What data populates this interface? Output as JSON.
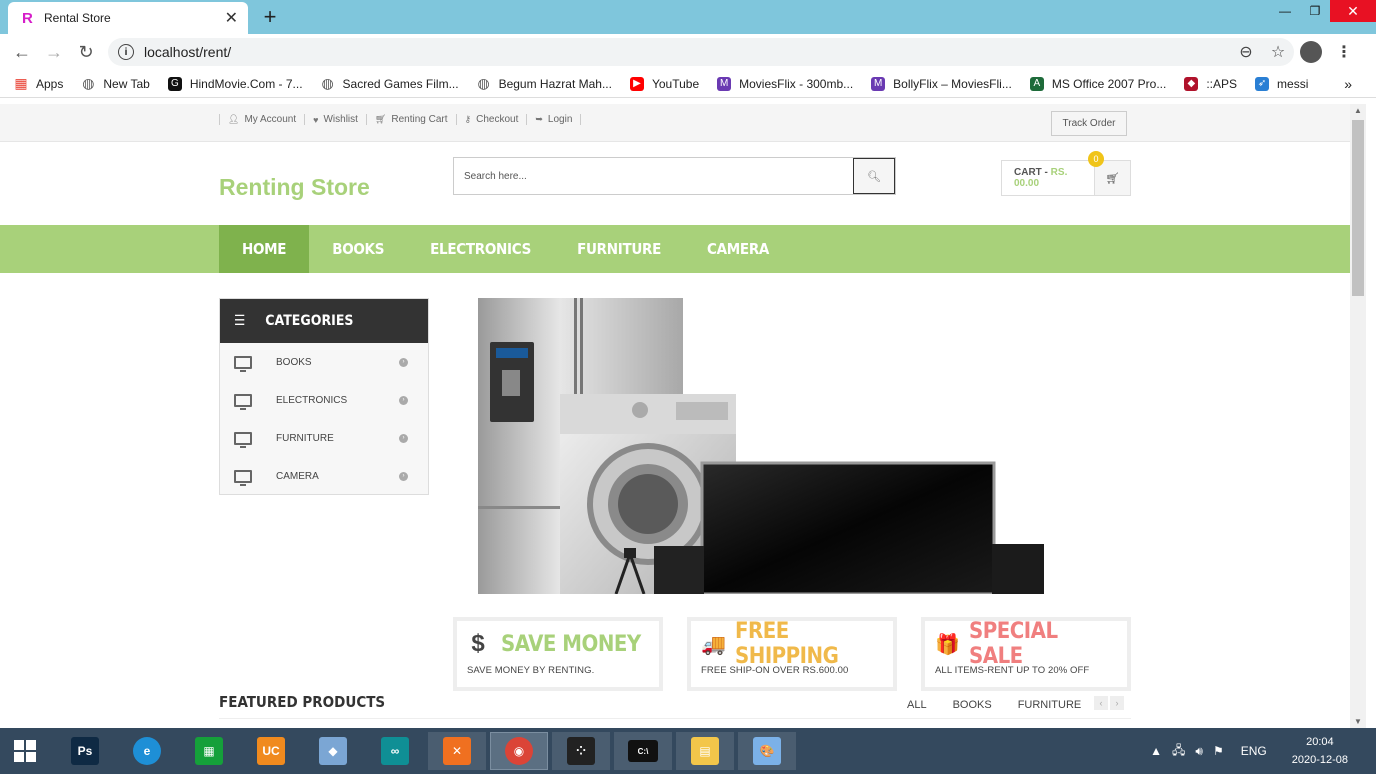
{
  "browser": {
    "tab_title": "Rental Store",
    "tab_favicon": "R",
    "url": "localhost/rent/",
    "bookmarks": [
      {
        "label": "Apps",
        "icon": "apps-grid-icon",
        "color": "#e94235"
      },
      {
        "label": "New Tab",
        "icon": "globe-icon",
        "color": "#555555"
      },
      {
        "label": "HindMovie.Com - 7...",
        "icon": "g-icon",
        "color": "#111111"
      },
      {
        "label": "Sacred Games Film...",
        "icon": "globe-icon",
        "color": "#555555"
      },
      {
        "label": "Begum Hazrat Mah...",
        "icon": "globe-icon",
        "color": "#555555"
      },
      {
        "label": "YouTube",
        "icon": "youtube-icon",
        "color": "#ff0000"
      },
      {
        "label": "MoviesFlix - 300mb...",
        "icon": "m-icon",
        "color": "#6a3ab2"
      },
      {
        "label": "BollyFlix – MoviesFli...",
        "icon": "m-icon",
        "color": "#6a3ab2"
      },
      {
        "label": "MS Office 2007 Pro...",
        "icon": "act-icon",
        "color": "#1e6b3a"
      },
      {
        "label": "::APS",
        "icon": "aps-icon",
        "color": "#b0122b"
      },
      {
        "label": "messi",
        "icon": "messi-icon",
        "color": "#2a7fd4"
      }
    ],
    "bookmarks_more": "»"
  },
  "site": {
    "top_links": [
      {
        "label": "My Account",
        "icon": "user-icon"
      },
      {
        "label": "Wishlist",
        "icon": "heart-icon"
      },
      {
        "label": "Renting Cart",
        "icon": "cart-icon"
      },
      {
        "label": "Checkout",
        "icon": "key-icon"
      },
      {
        "label": "Login",
        "icon": "sign-in-icon"
      }
    ],
    "track_order": "Track Order",
    "logo": "Renting Store",
    "search_placeholder": "Search here...",
    "cart_label": "CART - ",
    "cart_amount": "RS. 00.00",
    "cart_count": "0",
    "nav": [
      {
        "label": "HOME",
        "active": true
      },
      {
        "label": "BOOKS",
        "active": false
      },
      {
        "label": "ELECTRONICS",
        "active": false
      },
      {
        "label": "FURNITURE",
        "active": false
      },
      {
        "label": "CAMERA",
        "active": false
      }
    ],
    "categories_title": "CATEGORIES",
    "categories": [
      "BOOKS",
      "ELECTRONICS",
      "FURNITURE",
      "CAMERA"
    ],
    "features": [
      {
        "icon": "dollar-icon",
        "glyph": "$",
        "title": "SAVE MONEY",
        "subtitle": "SAVE MONEY BY RENTING.",
        "color": "#a8d17a"
      },
      {
        "icon": "truck-icon",
        "glyph": "🚚",
        "title": "FREE SHIPPING",
        "subtitle": "FREE SHIP-ON OVER RS.600.00",
        "color": "#f0b94a"
      },
      {
        "icon": "gift-icon",
        "glyph": "🎁",
        "title": "SPECIAL SALE",
        "subtitle": "ALL ITEMS-RENT UP TO 20% OFF",
        "color": "#f07f7f"
      }
    ],
    "featured_heading": "FEATURED PRODUCTS",
    "featured_tabs": [
      "ALL",
      "BOOKS",
      "FURNITURE"
    ]
  },
  "taskbar": {
    "apps": [
      {
        "name": "photoshop-app",
        "glyph": "Ps",
        "color": "#0f2a44",
        "state": "pinned"
      },
      {
        "name": "internet-explorer-app",
        "glyph": "e",
        "color": "#1e8fd6",
        "state": "pinned"
      },
      {
        "name": "store-app",
        "glyph": "▦",
        "color": "#15a03a",
        "state": "pinned"
      },
      {
        "name": "uc-browser-app",
        "glyph": "UC",
        "color": "#f08a1e",
        "state": "pinned"
      },
      {
        "name": "virtualbox-app",
        "glyph": "◆",
        "color": "#7ba6d4",
        "state": "pinned"
      },
      {
        "name": "arduino-app",
        "glyph": "∞",
        "color": "#0f8f95",
        "state": "pinned"
      },
      {
        "name": "xampp-app",
        "glyph": "✕",
        "color": "#f07020",
        "state": "open"
      },
      {
        "name": "chrome-app",
        "glyph": "◉",
        "color": "#db4437",
        "state": "active"
      },
      {
        "name": "davinci-app",
        "glyph": "⁘",
        "color": "#222222",
        "state": "open"
      },
      {
        "name": "cmd-app",
        "glyph": "C:\\",
        "color": "#111111",
        "state": "open"
      },
      {
        "name": "file-explorer-app",
        "glyph": "▤",
        "color": "#f3c64a",
        "state": "open"
      },
      {
        "name": "paint-app",
        "glyph": "🎨",
        "color": "#7bb1e8",
        "state": "open"
      }
    ],
    "lang": "ENG",
    "time": "20:04",
    "date": "2020-12-08"
  }
}
